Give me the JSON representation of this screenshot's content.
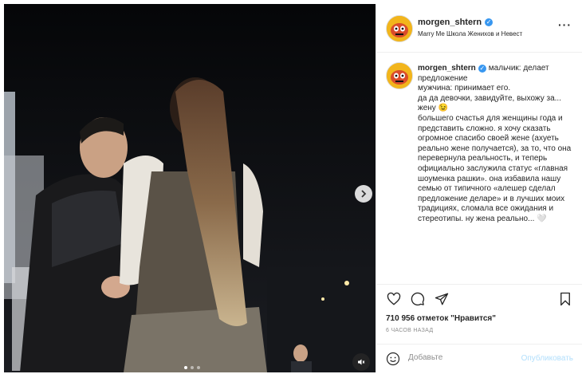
{
  "post": {
    "username": "morgen_shtern",
    "location": "Marry Me Школа Женихов и Невест",
    "more_icon": "more-horizontal-icon"
  },
  "caption": {
    "username": "morgen_shtern",
    "text": "мальчик: делает предложение\nмужчина: принимает его.\nда да девочки, завидуйте, выхожу за... жену 😉\nбольшего счастья для женщины года и представить сложно. я хочу сказать огромное спасибо своей жене (ахуеть реально жене получается), за то, что она перевернула реальность, и теперь официально заслужила статус «главная шоуменка рашки». она избавила нашу семью от типичного «алешер сделал предложение деларе» и в лучших моих традициях, сломала все ожидания и стереотипы. ну жена реально... 🤍"
  },
  "stats": {
    "likes": "710 956 отметок \"Нравится\"",
    "time": "6 ЧАСОВ НАЗАД"
  },
  "comment": {
    "placeholder": "Добавьте",
    "publish_label": "Опубликовать"
  },
  "carousel": {
    "slides": 3,
    "active_index": 0
  },
  "colors": {
    "verified": "#3897f0",
    "publish_disabled": "#b2dffc",
    "avatar_bg": "#f2b51c"
  }
}
